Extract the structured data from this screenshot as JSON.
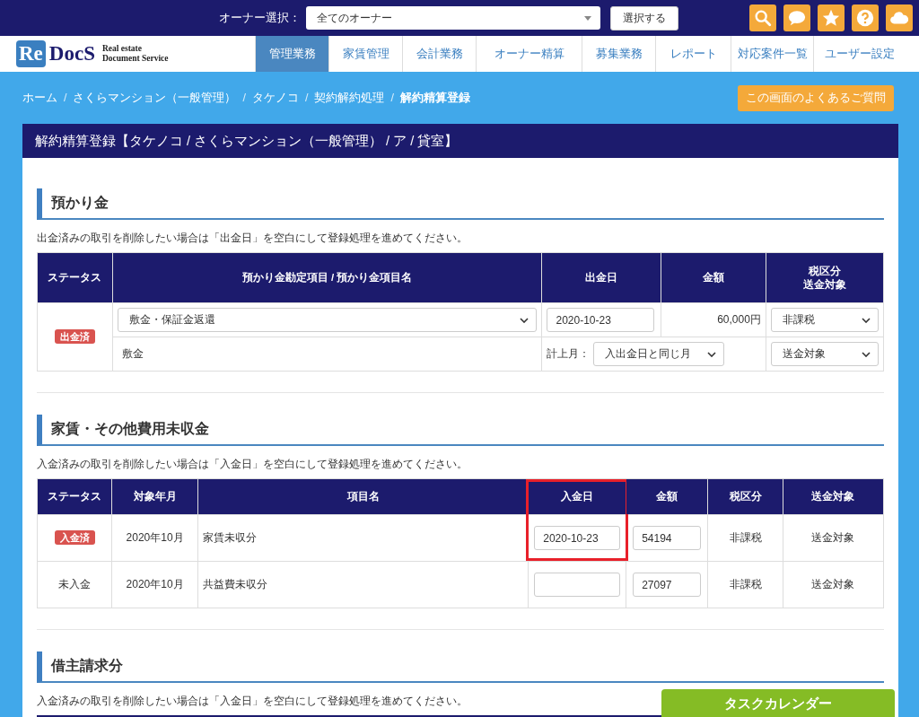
{
  "top_bar": {
    "owner_label": "オーナー選択：",
    "owner_select": "全てのオーナー",
    "select_button": "選択する",
    "icons": [
      {
        "kind": "search"
      },
      {
        "kind": "chat"
      },
      {
        "kind": "star"
      },
      {
        "kind": "help"
      },
      {
        "kind": "cloud"
      }
    ]
  },
  "logo": {
    "mark": "Re",
    "name": "DocS",
    "tagline_1": "Real estate",
    "tagline_2": "Document Service"
  },
  "nav": [
    {
      "label": "管理業務",
      "selected": true
    },
    {
      "label": "家賃管理",
      "selected": false
    },
    {
      "label": "会計業務",
      "selected": false
    },
    {
      "label": "オーナー精算",
      "selected": false
    },
    {
      "label": "募集業務",
      "selected": false
    },
    {
      "label": "レポート",
      "selected": false
    },
    {
      "label": "対応案件一覧",
      "selected": false
    },
    {
      "label": "ユーザー設定",
      "selected": false
    }
  ],
  "breadcrumb": [
    {
      "label": "ホーム",
      "current": false
    },
    {
      "separator": "/",
      "label": "さくらマンション（一般管理）",
      "current": false
    },
    {
      "separator": "/",
      "label": "タケノコ",
      "current": false
    },
    {
      "separator": "/",
      "label": "契約解約処理",
      "current": false
    },
    {
      "separator": "/",
      "label": "解約精算登録",
      "current": true
    }
  ],
  "faq_button": "この画面のよくあるご質問",
  "page_title": "解約精算登録【タケノコ / さくらマンション（一般管理） / ア / 貸室】",
  "deposits": {
    "title": "預かり金",
    "note": "出金済みの取引を削除したい場合は「出金日」を空白にして登録処理を進めてください。",
    "columns": [
      {
        "lines": [
          "ステータス"
        ]
      },
      {
        "lines": [
          "預かり金勘定項目 / 預かり金項目名"
        ]
      },
      {
        "lines": [
          "出金日"
        ]
      },
      {
        "lines": [
          "金額"
        ]
      },
      {
        "lines": [
          "税区分",
          "送金対象"
        ]
      }
    ],
    "rows": [
      {
        "status": {
          "label": "出金済",
          "kind": "badge"
        },
        "account": "敷金・保証金返還",
        "item_name": "敷金",
        "date": "2020-10-23",
        "month_label": "計上月：",
        "month": "入出金日と同じ月",
        "amount": "60,000円",
        "tax": "非課税",
        "remittance": "送金対象"
      }
    ]
  },
  "arrears": {
    "title": "家賃・その他費用未収金",
    "note": "入金済みの取引を削除したい場合は「入金日」を空白にして登録処理を進めてください。",
    "columns": [
      {
        "label": "ステータス",
        "highlighted": false
      },
      {
        "label": "対象年月",
        "highlighted": false
      },
      {
        "label": "項目名",
        "highlighted": false
      },
      {
        "label": "入金日",
        "highlighted": true
      },
      {
        "label": "金額",
        "highlighted": false
      },
      {
        "label": "税区分",
        "highlighted": false
      },
      {
        "label": "送金対象",
        "highlighted": false
      }
    ],
    "rows": [
      {
        "status": {
          "label": "入金済",
          "kind": "badge"
        },
        "month": "2020年10月",
        "item": "家賃未収分",
        "date": "2020-10-23",
        "amount": "54194",
        "tax": "非課税",
        "remittance": "送金対象"
      },
      {
        "status": {
          "label": "未入金",
          "kind": "plain"
        },
        "month": "2020年10月",
        "item": "共益費未収分",
        "amount": "27097",
        "tax": "非課税",
        "remittance": "送金対象"
      }
    ]
  },
  "tenant_charges": {
    "title": "借主請求分",
    "note": "入金済みの取引を削除したい場合は「入金日」を空白にして登録処理を進めてください。"
  },
  "task_calendar_button": "タスクカレンダー"
}
